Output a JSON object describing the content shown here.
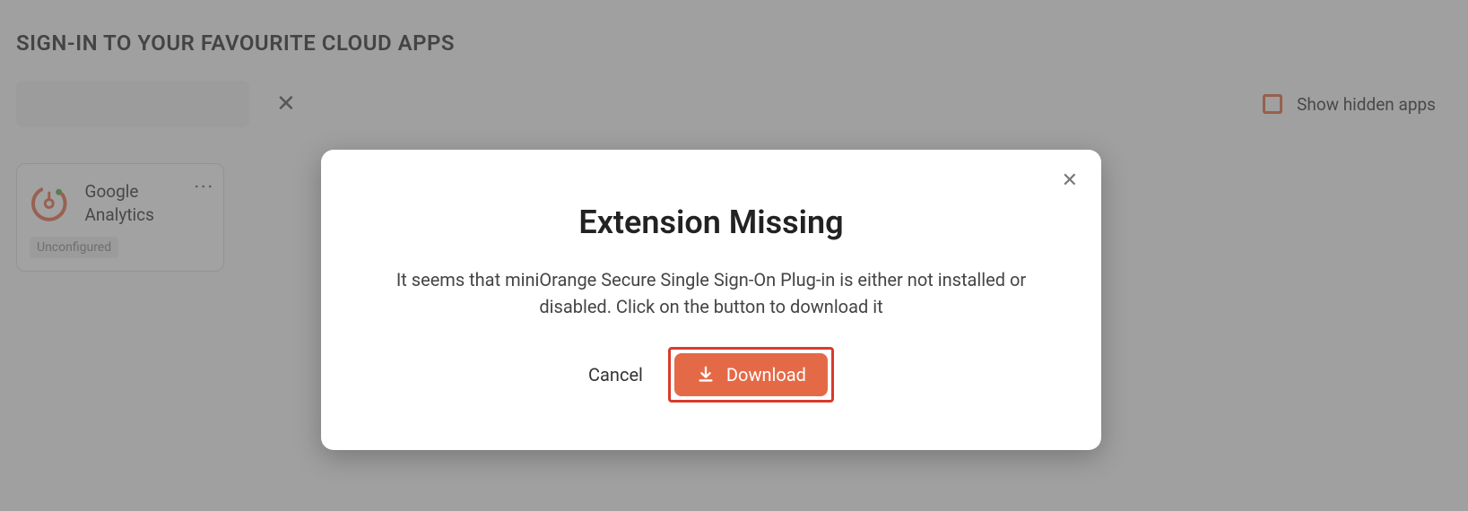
{
  "page": {
    "title": "SIGN-IN TO YOUR FAVOURITE CLOUD APPS"
  },
  "toolbar": {
    "show_hidden_label": "Show hidden apps"
  },
  "app": {
    "name": "Google Analytics",
    "status": "Unconfigured"
  },
  "modal": {
    "title": "Extension Missing",
    "body": "It seems that miniOrange Secure Single Sign-On Plug-in is either not installed or disabled. Click on the button to download it",
    "cancel_label": "Cancel",
    "download_label": "Download"
  },
  "colors": {
    "accent": "#e46a47",
    "highlight_border": "#d83a2b"
  }
}
